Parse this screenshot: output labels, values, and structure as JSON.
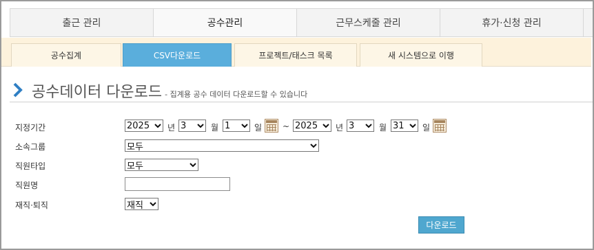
{
  "top_tabs": [
    {
      "label": "출근 관리",
      "active": false
    },
    {
      "label": "공수관리",
      "active": true
    },
    {
      "label": "근무스케줄 관리",
      "active": false
    },
    {
      "label": "휴가·신청 관리",
      "active": false
    }
  ],
  "sub_tabs": [
    {
      "label": "공수집계",
      "active": false
    },
    {
      "label": "CSV다운로드",
      "active": true
    },
    {
      "label": "프로젝트/태스크 목록",
      "active": false
    },
    {
      "label": "새 시스템으로 이행",
      "active": false
    }
  ],
  "page": {
    "title": "공수데이터 다운로드",
    "subtitle": "- 집계용 공수 데이터 다운로드할 수 있습니다"
  },
  "form": {
    "period_label": "지정기간",
    "start_year": "2025",
    "start_month": "3",
    "start_day": "1",
    "end_year": "2025",
    "end_month": "3",
    "end_day": "31",
    "unit_year": "년",
    "unit_month": "월",
    "unit_day": "일",
    "range_sep": "~",
    "group_label": "소속그룹",
    "group_value": "모두",
    "type_label": "직원타입",
    "type_value": "모두",
    "name_label": "직원명",
    "name_value": "",
    "status_label": "재직·퇴직",
    "status_value": "재직",
    "download_label": "다운로드"
  },
  "colors": {
    "accent_blue": "#5aaedc",
    "sub_bar_bg": "#fdf2dc",
    "chevron": "#2f7fc4"
  },
  "icons": {
    "title_icon": "chevron-right-icon",
    "calendar_icon": "calendar-icon",
    "dropdown_icon": "chevron-down-icon"
  }
}
